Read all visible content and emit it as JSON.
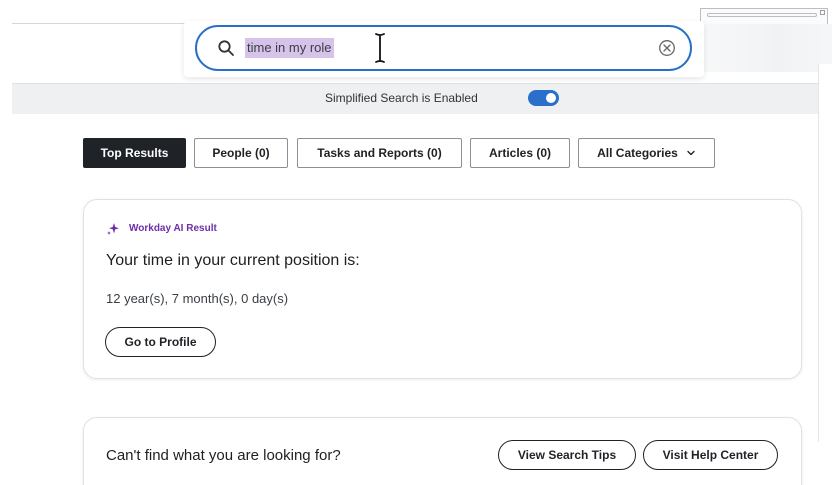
{
  "search": {
    "query": "time in my role"
  },
  "simplified_search": {
    "label": "Simplified Search is Enabled",
    "enabled": true
  },
  "tabs": [
    {
      "label": "Top Results",
      "active": true
    },
    {
      "label": "People (0)",
      "active": false
    },
    {
      "label": "Tasks and Reports (0)",
      "active": false
    },
    {
      "label": "Articles (0)",
      "active": false
    },
    {
      "label": "All Categories",
      "active": false,
      "dropdown": true
    }
  ],
  "ai_result": {
    "badge": "Workday AI Result",
    "heading": "Your time in your current position is:",
    "value": "12 year(s), 7 month(s), 0 day(s)",
    "button": "Go to Profile"
  },
  "help": {
    "prompt": "Can't find what you are looking for?",
    "search_tips_button": "View Search Tips",
    "help_center_button": "Visit Help Center"
  },
  "colors": {
    "accent": "#2a6fc9",
    "ai_purple": "#6d2ea8",
    "selection": "#d7c2e9",
    "active_tab": "#1f2226"
  },
  "icons": {
    "search": "search-icon",
    "clear": "clear-icon",
    "sparkle": "sparkle-icon",
    "chevron": "chevron-down-icon",
    "cursor": "text-cursor-icon"
  }
}
